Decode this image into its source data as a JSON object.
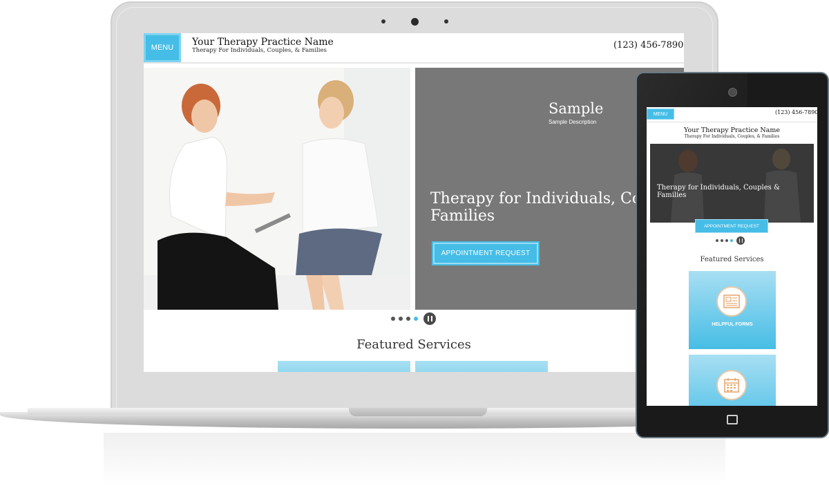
{
  "laptop_site": {
    "menu_label": "MENU",
    "practice_name": "Your Therapy Practice Name",
    "tagline": "Therapy For Individuals, Couples, & Families",
    "phone": "(123) 456-7890",
    "slide": {
      "title": "Sample",
      "description": "Sample Description",
      "headline": "Therapy for Individuals, Couples, & Families",
      "cta_label": "APPOINTMENT REQUEST"
    },
    "slider": {
      "dot_count": 4,
      "active_dot": 4
    },
    "featured_heading": "Featured Services"
  },
  "tablet_site": {
    "menu_label": "MENU",
    "phone": "(123) 456-7890",
    "practice_name": "Your Therapy Practice Name",
    "tagline": "Therapy For Individuals, Couples, & Families",
    "headline": "Therapy for Individuals, Couples & Families",
    "cta_label": "APPOINTMENT REQUEST",
    "slider": {
      "dot_count": 4,
      "active_dot": 4
    },
    "featured_heading": "Featured Services",
    "service_cards": [
      {
        "label": "HELPFUL FORMS",
        "icon": "forms-icon"
      },
      {
        "label": "",
        "icon": "calendar-icon"
      }
    ]
  },
  "colors": {
    "accent": "#45bde6",
    "slide_gray": "#787878",
    "icon_accent": "#e6a972"
  }
}
